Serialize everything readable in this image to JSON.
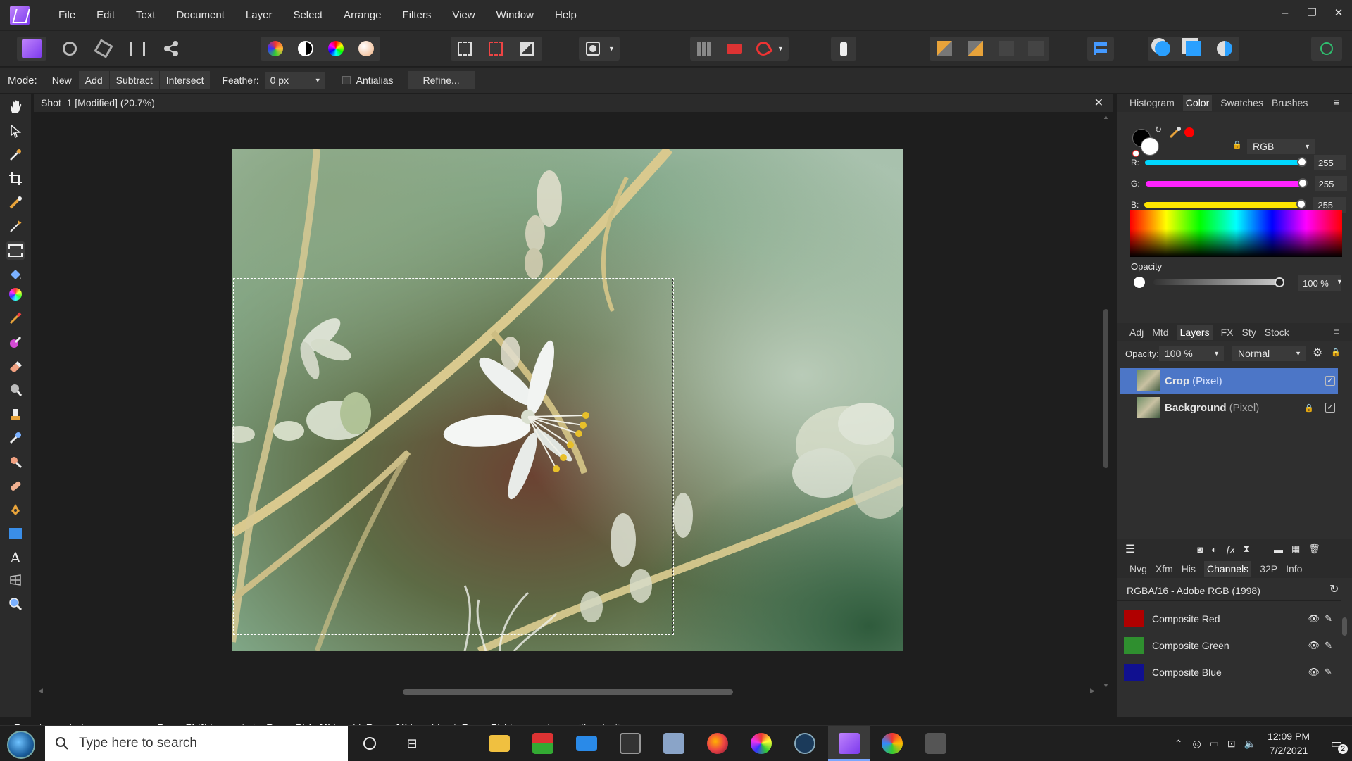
{
  "menubar": {
    "items": [
      "File",
      "Edit",
      "Text",
      "Document",
      "Layer",
      "Select",
      "Arrange",
      "Filters",
      "View",
      "Window",
      "Help"
    ],
    "window_controls": [
      "–",
      "❐",
      "✕"
    ]
  },
  "context": {
    "mode_label": "Mode:",
    "modes": [
      "New",
      "Add",
      "Subtract",
      "Intersect"
    ],
    "feather_label": "Feather:",
    "feather_value": "0 px",
    "antialias_label": "Antialias",
    "refine_label": "Refine..."
  },
  "document": {
    "tab_title": "Shot_1 [Modified] (20.7%)",
    "close": "✕"
  },
  "color_panel": {
    "tabs": [
      "Histogram",
      "Color",
      "Swatches",
      "Brushes"
    ],
    "active_tab": "Color",
    "model": "RGB",
    "channels": [
      {
        "label": "R:",
        "value": "255",
        "color": "#00d8ff"
      },
      {
        "label": "G:",
        "value": "255",
        "color": "#ff22ff"
      },
      {
        "label": "B:",
        "value": "255",
        "color": "#ffe600"
      }
    ],
    "opacity_label": "Opacity",
    "opacity_value": "100 %"
  },
  "layers_panel": {
    "tabs": [
      "Adj",
      "Mtd",
      "Layers",
      "FX",
      "Sty",
      "Stock"
    ],
    "active_tab": "Layers",
    "opacity_label": "Opacity:",
    "opacity_value": "100 %",
    "blend_mode": "Normal",
    "layers": [
      {
        "name": "Crop",
        "type": "(Pixel)",
        "selected": true
      },
      {
        "name": "Background",
        "type": "(Pixel)",
        "selected": false
      }
    ]
  },
  "channels_panel": {
    "tabs": [
      "Nvg",
      "Xfm",
      "His",
      "Channels",
      "32P",
      "Info"
    ],
    "active_tab": "Channels",
    "format": "RGBA/16 - Adobe RGB (1998)",
    "channels": [
      {
        "name": "Composite Red",
        "swatch": "#b00000"
      },
      {
        "name": "Composite Green",
        "swatch": "#2f8f2f"
      },
      {
        "name": "Composite Blue",
        "swatch": "#101090"
      }
    ]
  },
  "status": {
    "parts": [
      {
        "b": "Drag",
        "t": " to create / move marquee. "
      },
      {
        "b": "Drag",
        "t": "+"
      },
      {
        "b": "Shift",
        "t": " to constrain. "
      },
      {
        "b": "Drag",
        "t": "+"
      },
      {
        "b": "Ctrl",
        "t": "+"
      },
      {
        "b": "Alt",
        "t": " to add. "
      },
      {
        "b": "Drag",
        "t": "+"
      },
      {
        "b": "Alt",
        "t": " to subtract. "
      },
      {
        "b": "Drag",
        "t": "+"
      },
      {
        "b": "Ctrl",
        "t": " to move layer with selection."
      }
    ]
  },
  "taskbar": {
    "search_placeholder": "Type here to search",
    "time": "12:09 PM",
    "date": "7/2/2021",
    "notification_count": "2"
  }
}
